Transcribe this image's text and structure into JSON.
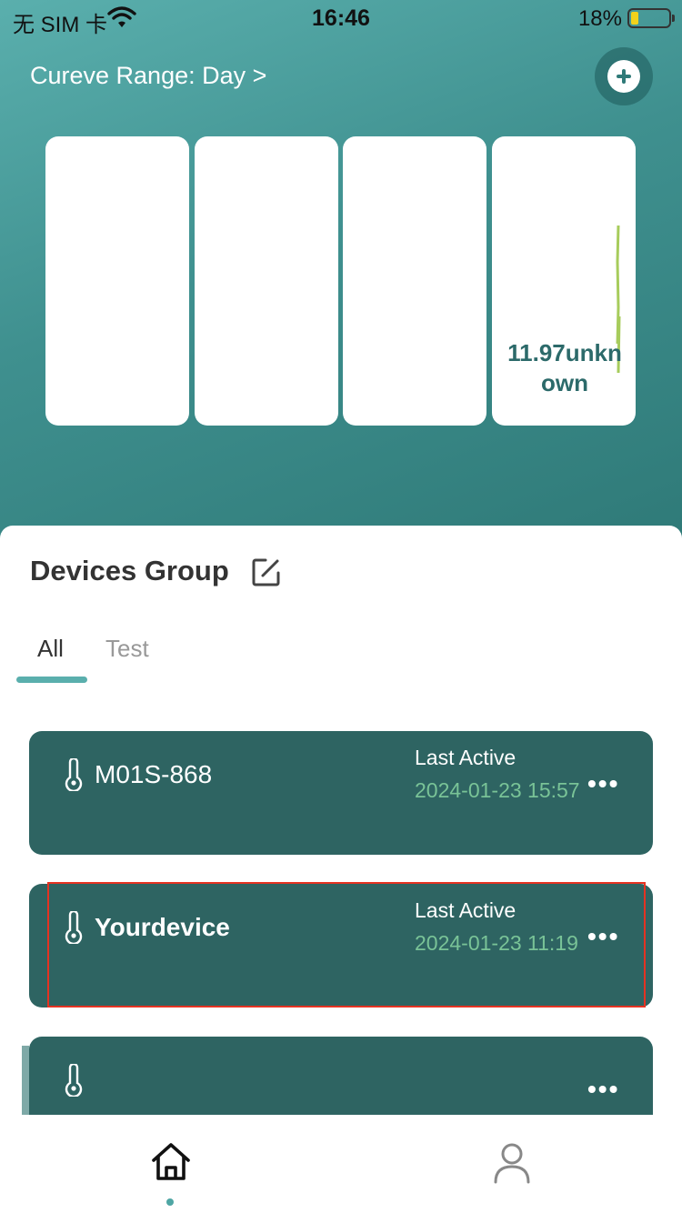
{
  "status_bar": {
    "carrier": "无 SIM 卡",
    "time": "16:46",
    "battery": "18%"
  },
  "header": {
    "range_label": "Cureve Range: Day >",
    "add_icon": "plus-circle-icon"
  },
  "cards": [
    {
      "value": ""
    },
    {
      "value": ""
    },
    {
      "value": ""
    },
    {
      "value": "11.97unknown"
    }
  ],
  "devices_group": {
    "title": "Devices Group",
    "edit_icon": "edit-icon",
    "tabs": [
      {
        "label": "All",
        "active": true
      },
      {
        "label": "Test",
        "active": false
      }
    ],
    "devices": [
      {
        "name": "M01S-868",
        "last_active_label": "Last Active",
        "last_active": "2024-01-23 15:57",
        "more": "•••"
      },
      {
        "name": "Yourdevice",
        "last_active_label": "Last Active",
        "last_active": "2024-01-23 11:19",
        "more": "•••"
      },
      {
        "name": "",
        "last_active_label": "",
        "last_active": "",
        "more": "•••"
      }
    ]
  },
  "bottom_nav": [
    {
      "icon": "home-icon",
      "active": true
    },
    {
      "icon": "profile-icon",
      "active": false
    }
  ],
  "colors": {
    "accent": "#5aafad",
    "card_bg": "#2e6462",
    "active_time": "#79c397",
    "highlight": "#e53322"
  }
}
